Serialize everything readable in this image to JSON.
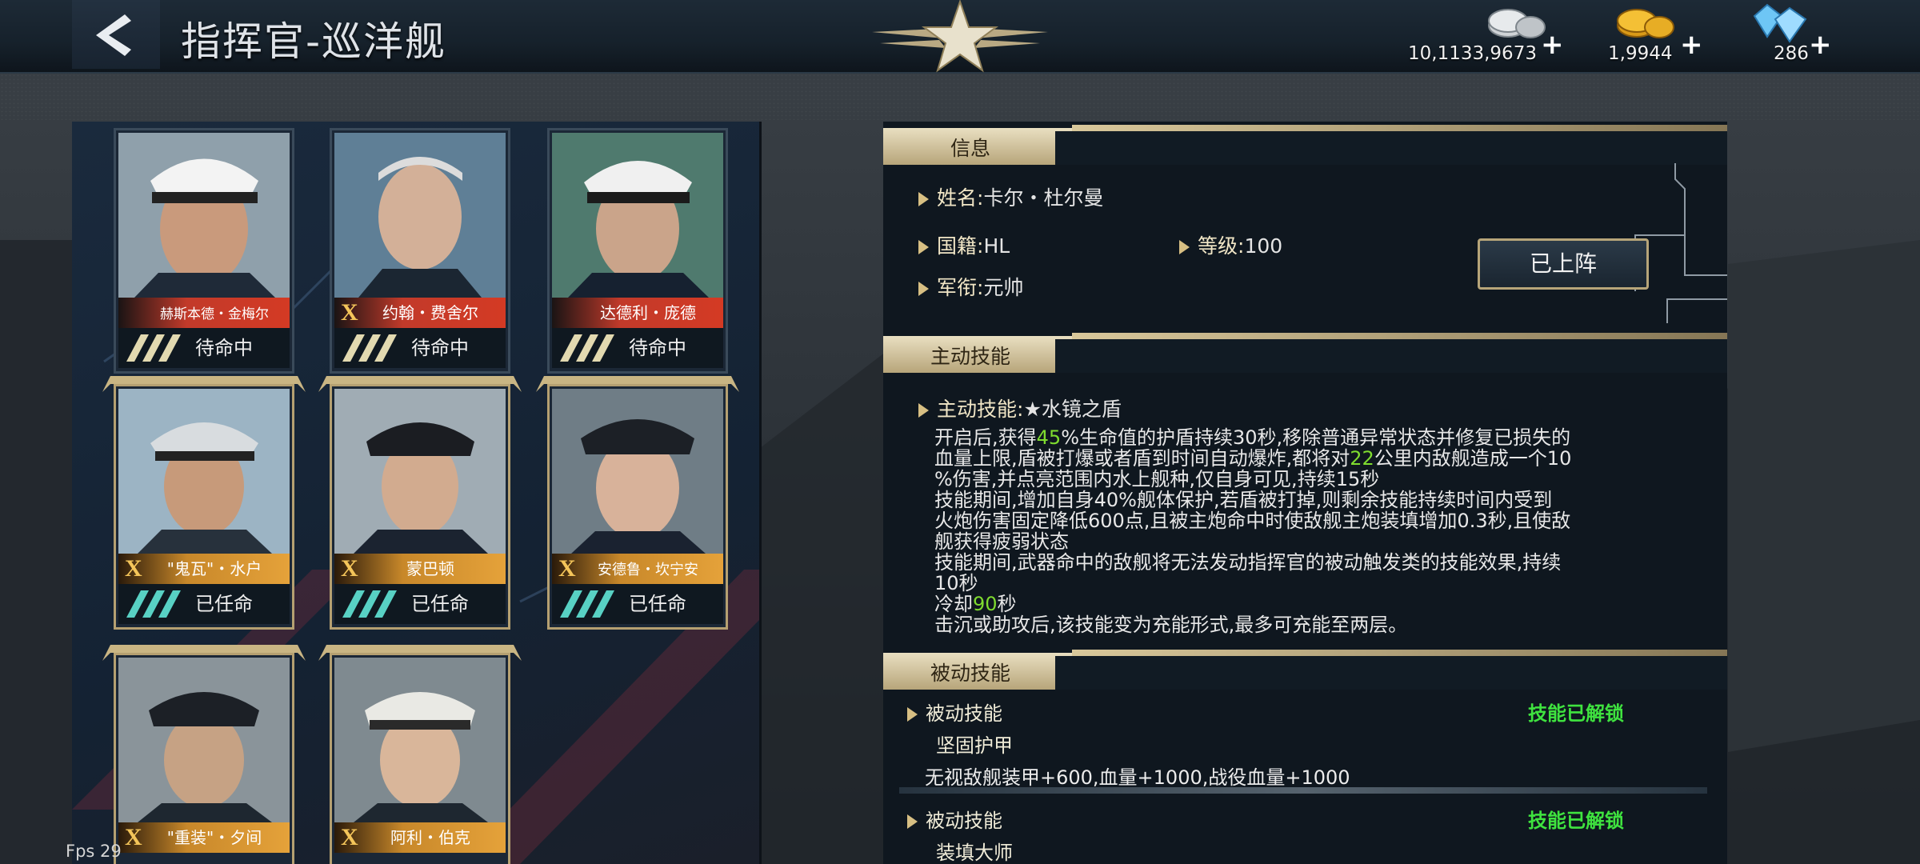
{
  "header": {
    "title": "指挥官-巡洋舰",
    "currencies": [
      {
        "icon": "silver-coins-icon",
        "amount": "10,1133,9673"
      },
      {
        "icon": "gold-coins-icon",
        "amount": "1,9944"
      },
      {
        "icon": "diamonds-icon",
        "amount": "286"
      }
    ],
    "plus": "+"
  },
  "commanders": [
    {
      "name": "赫斯本德・金梅尔",
      "status": "待命中",
      "mark": ""
    },
    {
      "name": "约翰・费舍尔",
      "status": "待命中",
      "mark": "X"
    },
    {
      "name": "达德利・庞德",
      "status": "待命中",
      "mark": ""
    },
    {
      "name": "\"鬼瓦\"・水户",
      "status": "已任命",
      "mark": "X"
    },
    {
      "name": "蒙巴顿",
      "status": "已任命",
      "mark": "X"
    },
    {
      "name": "安德鲁・坎宁安",
      "status": "已任命",
      "mark": "X"
    },
    {
      "name": "\"重装\"・夕间",
      "status": "",
      "mark": "X"
    },
    {
      "name": "阿利・伯克",
      "status": "",
      "mark": "X"
    }
  ],
  "info": {
    "section_title": "信息",
    "name_label": "姓名:",
    "name_value": "卡尔・杜尔曼",
    "nationality_label": "国籍:",
    "nationality_value": "HL",
    "level_label": "等级:",
    "level_value": "100",
    "rank_label": "军衔:",
    "rank_value": "元帅",
    "deployed_button": "已上阵"
  },
  "active_skill": {
    "section_title": "主动技能",
    "label": "主动技能:",
    "name": "★水镜之盾",
    "p1_a": "开启后,获得",
    "p1_b": "45",
    "p1_c": "%生命值的护盾持续30秒,移除普通异常状态并修复已损失的",
    "p2_a": "血量上限,盾被打爆或者盾到时间自动爆炸,都将对",
    "p2_b": "22",
    "p2_c": "公里内敌舰造成一个10",
    "p3": "%伤害,并点亮范围内水上舰种,仅自身可见,持续15秒",
    "p4": "技能期间,增加自身40%舰体保护,若盾被打掉,则剩余技能持续时间内受到",
    "p5": "火炮伤害固定降低600点,且被主炮命中时使敌舰主炮装填增加0.3秒,且使敌",
    "p6": "舰获得疲弱状态",
    "p7": "技能期间,武器命中的敌舰将无法发动指挥官的被动触发类的技能效果,持续",
    "p8": "10秒",
    "p9_a": "冷却",
    "p9_b": "90",
    "p9_c": "秒",
    "p10": "击沉或助攻后,该技能变为充能形式,最多可充能至两层。"
  },
  "passive_skill": {
    "section_title": "被动技能",
    "items": [
      {
        "label": "被动技能",
        "status": "技能已解锁",
        "name": "坚固护甲",
        "desc": "无视敌舰装甲+600,血量+1000,战役血量+1000"
      },
      {
        "label": "被动技能",
        "status": "技能已解锁",
        "name": "装填大师",
        "desc": ""
      }
    ]
  },
  "fps": "Fps 29"
}
